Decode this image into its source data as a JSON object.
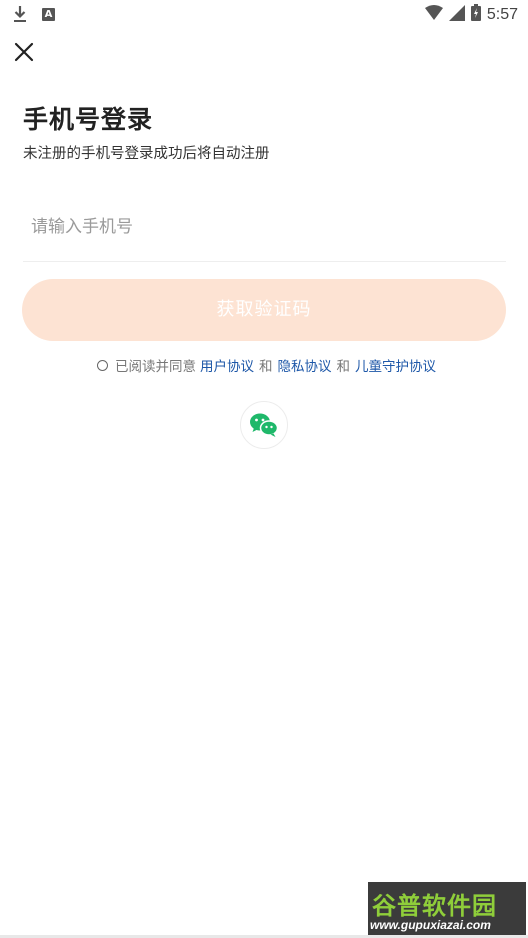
{
  "status_bar": {
    "time": "5:57",
    "left_icons": [
      "download-icon",
      "a-notification-icon"
    ],
    "right_icons": [
      "wifi-icon",
      "signal-icon",
      "battery-icon"
    ]
  },
  "header": {
    "close_icon": "close-icon"
  },
  "login": {
    "title": "手机号登录",
    "subtitle": "未注册的手机号登录成功后将自动注册",
    "phone_placeholder": "请输入手机号",
    "get_code_label": "获取验证码",
    "button_color": "#fde3d3"
  },
  "agreement": {
    "prefix": "已阅读并同意",
    "user_agreement": "用户协议",
    "and_1": "和",
    "privacy_agreement": "隐私协议",
    "and_2": "和",
    "child_agreement": "儿童守护协议",
    "link_color": "#1d57a8"
  },
  "third_party": {
    "wechat_icon": "wechat-icon",
    "wechat_color": "#1fb86a"
  },
  "watermark": {
    "top_text": "谷普软件园",
    "bottom_text": "www.gupuxiazai.com"
  }
}
